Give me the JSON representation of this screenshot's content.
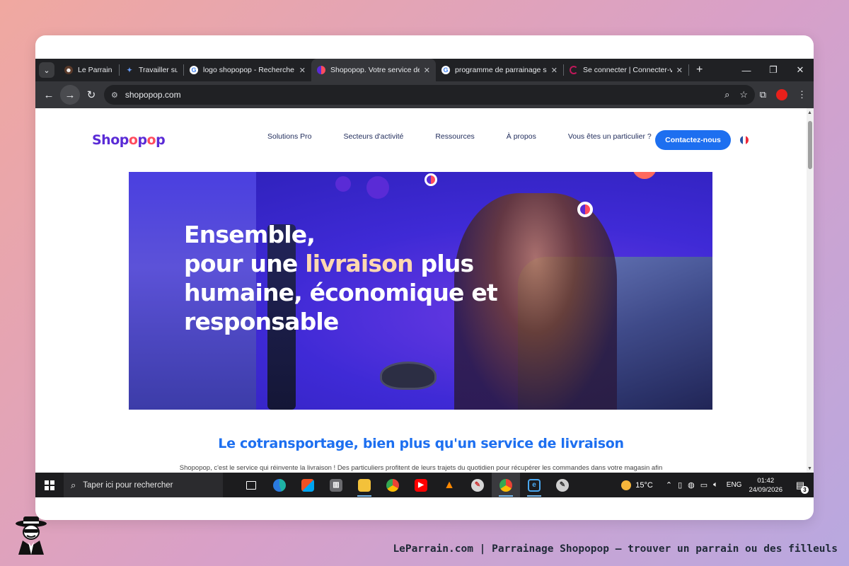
{
  "browser": {
    "tabs": [
      {
        "title": "Le Parrain - l",
        "favicon": "leparrain-icon",
        "active": false
      },
      {
        "title": "Travailler sur",
        "favicon": "gemini-icon",
        "active": false
      },
      {
        "title": "logo shopopop - Recherche",
        "favicon": "google-icon",
        "active": false
      },
      {
        "title": "Shopopop. Votre service de l",
        "favicon": "shopopop-icon",
        "active": true
      },
      {
        "title": "programme de parrainage sh",
        "favicon": "google-icon",
        "active": false
      },
      {
        "title": "Se connecter | Connecter-vo",
        "favicon": "connect-icon",
        "active": false
      }
    ],
    "new_tab_label": "+",
    "url": "shopopop.com"
  },
  "site": {
    "logo": {
      "part1": "Shop",
      "part2": "o",
      "part3": "p",
      "part4": "o",
      "part5": "p"
    },
    "nav": [
      "Solutions Pro",
      "Secteurs d'activité",
      "Ressources",
      "À propos",
      "Vous êtes un particulier ?"
    ],
    "cta": "Contactez-nous",
    "hero": {
      "line1": "Ensemble,",
      "line2_pre": "pour une ",
      "line2_hl": "livraison",
      "line2_post": " plus",
      "line3": "humaine, économique et",
      "line4": "responsable"
    },
    "section_title": "Le cotransportage, bien plus qu'un service de livraison",
    "section_body": "Shopopop, c'est le service qui réinvente la livraison ! Des particuliers profitent de leurs trajets du quotidien pour récupérer les commandes dans votre magasin afin"
  },
  "taskbar": {
    "search_placeholder": "Taper ici pour rechercher",
    "weather": "15°C",
    "language": "ENG",
    "time": "01:42",
    "date": "24/09/2026",
    "notifications": "3"
  },
  "footer": {
    "text": "LeParrain.com | Parrainage Shopopop — trouver un parrain ou des filleuls"
  },
  "colors": {
    "brand_purple": "#5a2bd6",
    "brand_blue": "#1d6ff0",
    "accent_red": "#ff4c5e"
  }
}
